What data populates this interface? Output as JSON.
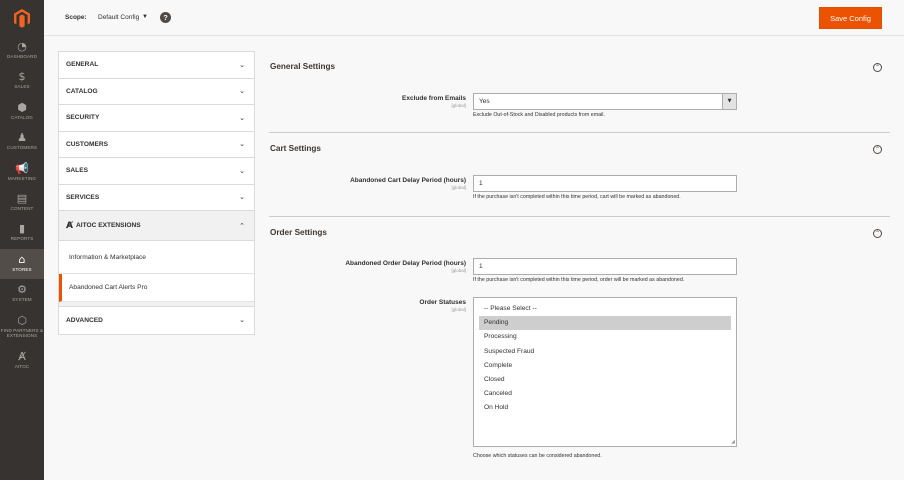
{
  "nav": {
    "items": [
      {
        "label": "DASHBOARD",
        "icon": "dashboard-icon",
        "glyph": "◔"
      },
      {
        "label": "SALES",
        "icon": "dollar-icon",
        "glyph": "$"
      },
      {
        "label": "CATALOG",
        "icon": "box-icon",
        "glyph": "⬢"
      },
      {
        "label": "CUSTOMERS",
        "icon": "person-icon",
        "glyph": "♟"
      },
      {
        "label": "MARKETING",
        "icon": "megaphone-icon",
        "glyph": "📢"
      },
      {
        "label": "CONTENT",
        "icon": "content-icon",
        "glyph": "▤"
      },
      {
        "label": "REPORTS",
        "icon": "bar-chart-icon",
        "glyph": "▮"
      },
      {
        "label": "STORES",
        "icon": "store-icon",
        "glyph": "⌂"
      },
      {
        "label": "SYSTEM",
        "icon": "gear-icon",
        "glyph": "⚙"
      },
      {
        "label": "FIND PARTNERS & EXTENSIONS",
        "icon": "partners-icon",
        "glyph": "⬡"
      },
      {
        "label": "AITOC",
        "icon": "aitoc-icon",
        "glyph": "Ⱥ"
      }
    ]
  },
  "header": {
    "scope_label": "Scope:",
    "scope_value": "Default Config",
    "help_glyph": "?",
    "save_label": "Save Config"
  },
  "tabs": {
    "general": "GENERAL",
    "catalog": "CATALOG",
    "security": "SECURITY",
    "customers": "CUSTOMERS",
    "sales": "SALES",
    "services": "SERVICES",
    "aitoc": "AITOC EXTENSIONS",
    "info_marketplace": "Information & Marketplace",
    "abandoned_cart": "Abandoned Cart Alerts Pro",
    "advanced": "ADVANCED"
  },
  "sections": {
    "general": {
      "title": "General Settings",
      "exclude_label": "Exclude from Emails",
      "exclude_scope": "[global]",
      "exclude_value": "Yes",
      "exclude_note": "Exclude Out-of-Stock and Disabled products from email."
    },
    "cart": {
      "title": "Cart Settings",
      "delay_label": "Abandoned Cart Delay Period (hours)",
      "delay_scope": "[global]",
      "delay_value": "1",
      "delay_note": "If the purchase isn't completed within this time period, cart will be marked as abandoned."
    },
    "order": {
      "title": "Order Settings",
      "delay_label": "Abandoned Order Delay Period (hours)",
      "delay_scope": "[global]",
      "delay_value": "1",
      "delay_note": "If the purchase isn't completed within this time period, order will be marked as abandoned.",
      "statuses_label": "Order Statuses",
      "statuses_scope": "[global]",
      "statuses_options": [
        "-- Please Select --",
        "Pending",
        "Processing",
        "Suspected Fraud",
        "Complete",
        "Closed",
        "Canceled",
        "On Hold"
      ],
      "statuses_selected": "Pending",
      "statuses_note": "Choose which statuses can be considered abandoned."
    }
  },
  "colors": {
    "accent": "#eb5202",
    "nav_bg": "#373330"
  }
}
